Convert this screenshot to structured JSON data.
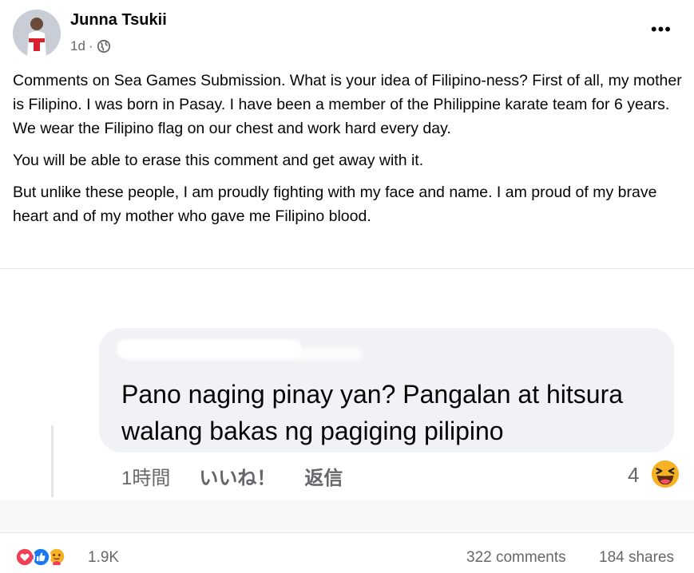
{
  "post": {
    "author": "Junna Tsukii",
    "time": "1d",
    "separator": "·",
    "paragraphs": [
      "Comments on Sea Games Submission. What is your idea of Filipino-ness? First of all, my mother is Filipino. I was born in Pasay. I have been a member of the Philippine karate team for 6 years. We wear the Filipino flag on our chest and work hard every day.",
      "You will be able to erase this comment and get away with it.",
      "But unlike these people, I am proudly fighting with my face and name. I am proud of my brave heart and of my mother who gave me Filipino blood."
    ]
  },
  "embedded_comment": {
    "text": "Pano naging pinay yan? Pangalan at hitsura walang bakas ng pagiging pilipino",
    "time": "1時間",
    "like_label": "いいね！",
    "reply_label": "返信",
    "reaction_count": "4"
  },
  "footer": {
    "reactions_total": "1.9K",
    "comments": "322 comments",
    "shares": "184 shares"
  },
  "icons": [
    "globe-icon",
    "more-options-icon",
    "love-reaction-icon",
    "like-reaction-icon",
    "care-reaction-icon",
    "haha-reaction-icon"
  ],
  "colors": {
    "secondary_text": "#65676b",
    "like_blue": "#1877f2",
    "love_red": "#f33e58",
    "haha_yellow": "#f7b125"
  }
}
